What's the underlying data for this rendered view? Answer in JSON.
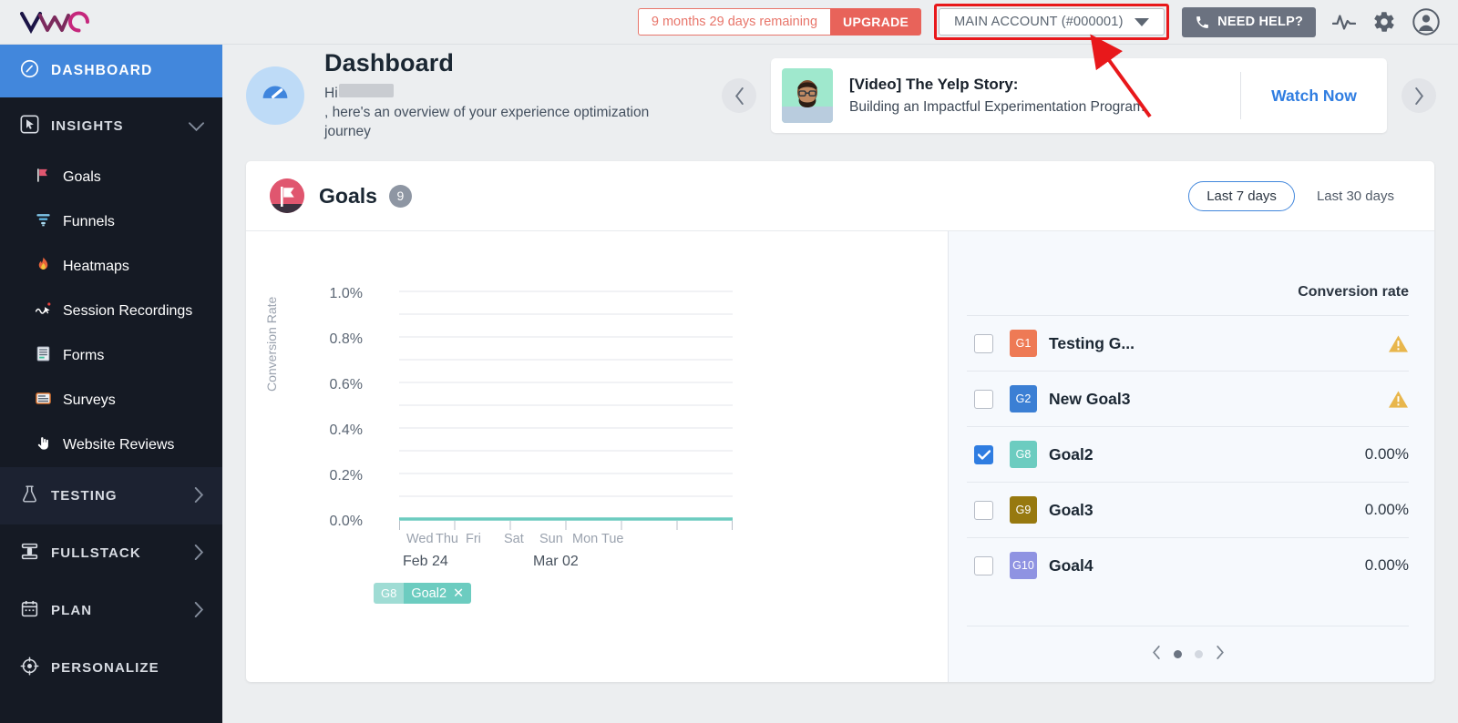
{
  "topbar": {
    "logo_name": "vwo-logo",
    "trial_text": "9 months 29 days remaining",
    "upgrade_label": "UPGRADE",
    "account_label": "MAIN ACCOUNT (#000001)",
    "help_label": "NEED HELP?",
    "icons": [
      "pulse-icon",
      "gear-icon",
      "user-avatar-icon"
    ],
    "highlight_color": "#e8181b",
    "upgrade_color": "#e8635a"
  },
  "sidebar": {
    "dashboard": {
      "label": "DASHBOARD",
      "icon": "speedometer-icon",
      "active": true,
      "active_color": "#4287dc"
    },
    "groups": [
      {
        "label": "INSIGHTS",
        "icon": "cursor-box-icon",
        "expanded": true,
        "chevron": "chevron-down-icon"
      },
      {
        "label": "TESTING",
        "icon": "flask-icon",
        "expanded": false,
        "chevron": "chevron-right-icon"
      },
      {
        "label": "FULLSTACK",
        "icon": "stack-icon",
        "expanded": false,
        "chevron": "chevron-right-icon"
      },
      {
        "label": "PLAN",
        "icon": "calendar-icon",
        "expanded": false,
        "chevron": "chevron-right-icon"
      },
      {
        "label": "PERSONALIZE",
        "icon": "target-icon",
        "expanded": false,
        "chevron": ""
      }
    ],
    "insights_items": [
      {
        "label": "Goals",
        "icon": "flag-icon"
      },
      {
        "label": "Funnels",
        "icon": "funnel-icon"
      },
      {
        "label": "Heatmaps",
        "icon": "fire-icon"
      },
      {
        "label": "Session Recordings",
        "icon": "recording-cursor-icon"
      },
      {
        "label": "Forms",
        "icon": "form-icon"
      },
      {
        "label": "Surveys",
        "icon": "survey-icon"
      },
      {
        "label": "Website Reviews",
        "icon": "hand-pointer-icon"
      }
    ]
  },
  "dashboard": {
    "icon": "speedometer-circle-icon",
    "title": "Dashboard",
    "greeting_prefix": "Hi",
    "greeting_suffix": ", here's an overview of your experience optimization journey",
    "prev_icon": "chevron-left-icon",
    "next_icon": "chevron-right-icon",
    "promo": {
      "thumb": "presenter-avatar",
      "title": "[Video] The Yelp Story:",
      "subtitle": "Building an Impactful Experimentation Program",
      "cta": "Watch Now"
    }
  },
  "goals_card": {
    "icon": "goal-flag-icon",
    "title": "Goals",
    "count": "9",
    "ranges": [
      {
        "label": "Last 7 days",
        "active": true
      },
      {
        "label": "Last 30 days",
        "active": false
      }
    ],
    "list_header": "Conversion rate",
    "rows": [
      {
        "tag": "G1",
        "name": "Testing G...",
        "value": "",
        "checked": false,
        "status": "warning-icon",
        "color": "#ee7a55"
      },
      {
        "tag": "G2",
        "name": "New Goal3",
        "value": "",
        "checked": false,
        "status": "warning-icon",
        "color": "#3b7fd4"
      },
      {
        "tag": "G8",
        "name": "Goal2",
        "value": "0.00%",
        "checked": true,
        "status": "",
        "color": "#6cccc0"
      },
      {
        "tag": "G9",
        "name": "Goal3",
        "value": "0.00%",
        "checked": false,
        "status": "",
        "color": "#97790f"
      },
      {
        "tag": "G10",
        "name": "Goal4",
        "value": "0.00%",
        "checked": false,
        "status": "",
        "color": "#8f93e2"
      }
    ],
    "pager": {
      "prev_icon": "chevron-left-icon",
      "next_icon": "chevron-right-icon",
      "pages": 2,
      "current": 1
    },
    "legend": {
      "tag": "G8",
      "label": "Goal2",
      "remove_icon": "close-icon",
      "color": "#6cccc0"
    }
  },
  "chart_data": {
    "type": "line",
    "title": "",
    "xlabel": "",
    "ylabel": "Conversion Rate",
    "ylim": [
      0,
      1.0
    ],
    "yticks": [
      "0.0%",
      "0.2%",
      "0.4%",
      "0.6%",
      "0.8%",
      "1.0%"
    ],
    "ytick_values": [
      0.0,
      0.2,
      0.4,
      0.6,
      0.8,
      1.0
    ],
    "grid": true,
    "categories": [
      "Wed",
      "Thu",
      "Fri",
      "Sat",
      "Sun",
      "Mon",
      "Tue"
    ],
    "x_range_start": "Feb 24",
    "x_range_end": "Mar 02",
    "series": [
      {
        "name": "Goal2",
        "color": "#6cccc0",
        "values": [
          0,
          0,
          0,
          0,
          0,
          0,
          0
        ]
      }
    ],
    "legend_position": "bottom-left"
  }
}
